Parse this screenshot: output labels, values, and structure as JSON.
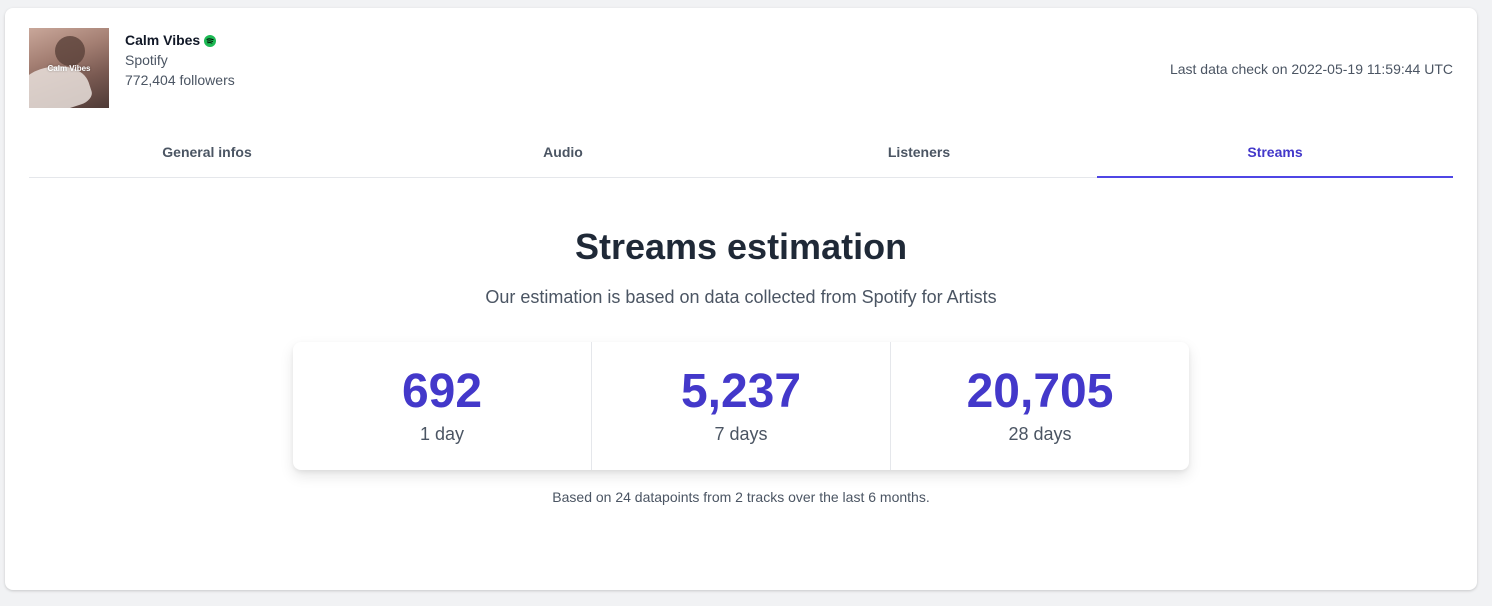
{
  "artist": {
    "cover_text": "Calm Vibes",
    "name": "Calm Vibes",
    "platform": "Spotify",
    "followers": "772,404 followers",
    "verified_icon": "spotify-icon",
    "verified_color": "#1db954"
  },
  "last_check": "Last data check on 2022-05-19 11:59:44 UTC",
  "tabs": [
    {
      "label": "General infos",
      "active": false
    },
    {
      "label": "Audio",
      "active": false
    },
    {
      "label": "Listeners",
      "active": false
    },
    {
      "label": "Streams",
      "active": true
    }
  ],
  "streams": {
    "title": "Streams estimation",
    "subtitle": "Our estimation is based on data collected from Spotify for Artists",
    "stats": [
      {
        "value": "692",
        "label": "1 day"
      },
      {
        "value": "5,237",
        "label": "7 days"
      },
      {
        "value": "20,705",
        "label": "28 days"
      }
    ],
    "footnote": "Based on 24 datapoints from 2 tracks over the last 6 months."
  },
  "colors": {
    "accent": "#4338ca",
    "text": "#4b5563",
    "heading": "#1f2937"
  }
}
